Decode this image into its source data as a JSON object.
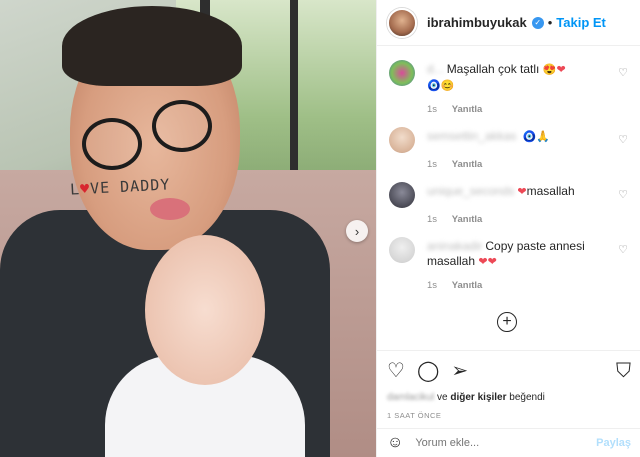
{
  "post": {
    "photo_alt": "",
    "onesie_text_left": "L",
    "onesie_text_right": "VE DADDY"
  },
  "header": {
    "username": "ibrahimbuyukak",
    "separator": "•",
    "follow_label": "Takip Et"
  },
  "comments": [
    {
      "user": "d...",
      "text": "Maşallah çok tatlı",
      "emojis": [
        "😍",
        "❤"
      ],
      "emojis2": [
        "🧿",
        "😊"
      ],
      "time": "1s",
      "reply": "Yanıtla",
      "avatar_color": "#7fbf5a"
    },
    {
      "user": "semsettin_akkas",
      "text": "",
      "emojis": [
        "🧿",
        "🙏"
      ],
      "emojis2": [],
      "time": "1s",
      "reply": "Yanıtla",
      "avatar_color": "#e8c9b0"
    },
    {
      "user": "unique_seconds",
      "text": "masallah",
      "emojis": [
        "❤"
      ],
      "emojis2": [],
      "time": "1s",
      "reply": "Yanıtla",
      "avatar_color": "#5b5b66"
    },
    {
      "user": "aninakadir",
      "text": "Copy paste annesi masallah",
      "emojis": [
        "❤",
        "❤"
      ],
      "emojis2": [],
      "time": "1s",
      "reply": "Yanıtla",
      "avatar_color": "#d7d7d7"
    }
  ],
  "actions": {
    "liked_by_name": "damlacikul",
    "liked_by_joiner": "ve",
    "liked_by_others": "diğer kişiler",
    "liked_by_suffix": "beğendi",
    "time_ago": "1 SAAT ÖNCE"
  },
  "add_comment": {
    "placeholder": "Yorum ekle...",
    "post_label": "Paylaş"
  }
}
